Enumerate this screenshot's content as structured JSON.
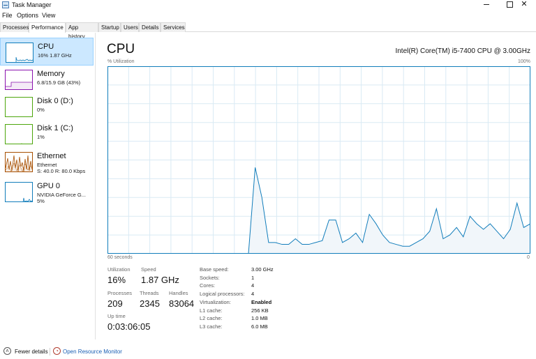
{
  "window": {
    "title": "Task Manager",
    "minimize": "",
    "maximize": "",
    "close": "✕"
  },
  "menu": {
    "items": [
      "File",
      "Options",
      "View"
    ]
  },
  "tabs": [
    "Processes",
    "Performance",
    "App history",
    "Startup",
    "Users",
    "Details",
    "Services"
  ],
  "active_tab": "Performance",
  "sidebar": {
    "items": [
      {
        "name": "CPU",
        "sub1": "16%  1.87 GHz",
        "sub2": "",
        "color": "#117dbb",
        "selected": true
      },
      {
        "name": "Memory",
        "sub1": "6.8/15.9 GB (43%)",
        "sub2": "",
        "color": "#8b12ae"
      },
      {
        "name": "Disk 0 (D:)",
        "sub1": "0%",
        "sub2": "",
        "color": "#4da60c"
      },
      {
        "name": "Disk 1 (C:)",
        "sub1": "1%",
        "sub2": "",
        "color": "#4da60c"
      },
      {
        "name": "Ethernet",
        "sub1": "Ethernet",
        "sub2": "S: 40.0  R: 80.0 Kbps",
        "color": "#a74f01"
      },
      {
        "name": "GPU 0",
        "sub1": "NVIDIA GeForce G...",
        "sub2": "5%",
        "color": "#117dbb"
      }
    ]
  },
  "main": {
    "title": "CPU",
    "cpu_model": "Intel(R) Core(TM) i5-7400 CPU @ 3.00GHz",
    "utilization_label": "% Utilization",
    "max_label": "100%",
    "time_label": "60 seconds",
    "min_label": "0",
    "stats": {
      "utilization_label": "Utilization",
      "utilization": "16%",
      "speed_label": "Speed",
      "speed": "1.87 GHz",
      "processes_label": "Processes",
      "processes": "209",
      "threads_label": "Threads",
      "threads": "2345",
      "handles_label": "Handles",
      "handles": "83064",
      "uptime_label": "Up time",
      "uptime": "0:03:06:05"
    },
    "details": [
      {
        "label": "Base speed:",
        "value": "3.00 GHz"
      },
      {
        "label": "Sockets:",
        "value": "1"
      },
      {
        "label": "Cores:",
        "value": "4"
      },
      {
        "label": "Logical processors:",
        "value": "4"
      },
      {
        "label": "Virtualization:",
        "value": "Enabled"
      },
      {
        "label": "L1 cache:",
        "value": "256 KB"
      },
      {
        "label": "L2 cache:",
        "value": "1.0 MB"
      },
      {
        "label": "L3 cache:",
        "value": "6.0 MB"
      }
    ]
  },
  "footer": {
    "fewer_details": "Fewer details",
    "open_resource_monitor": "Open Resource Monitor"
  },
  "colors": {
    "cpu_line": "#117dbb",
    "cpu_fill": "#f1f6fa",
    "grid": "#d9eaf4",
    "border": "#117dbb"
  },
  "chart_data": {
    "type": "area",
    "ylim": [
      0,
      100
    ],
    "x_seconds_ago": [
      60,
      41,
      39,
      37,
      35,
      33,
      31,
      29,
      27,
      26,
      24,
      22,
      20,
      19,
      17,
      16,
      14,
      12,
      11,
      9,
      8,
      6,
      4,
      3,
      2,
      1,
      0
    ],
    "values": [
      0,
      46,
      6,
      6,
      5,
      8,
      5,
      6,
      7,
      18,
      18,
      6,
      11,
      21,
      16,
      10,
      4,
      5,
      8,
      12,
      24,
      8,
      14,
      20,
      19,
      17,
      8
    ],
    "series_full": [
      0,
      0,
      0,
      0,
      0,
      0,
      0,
      0,
      0,
      0,
      0,
      0,
      0,
      0,
      0,
      0,
      0,
      0,
      0,
      0,
      0,
      0,
      46,
      30,
      6,
      6,
      5,
      5,
      8,
      5,
      5,
      6,
      7,
      18,
      18,
      6,
      8,
      11,
      6,
      21,
      16,
      10,
      6,
      5,
      4,
      4,
      6,
      8,
      12,
      24,
      8,
      10,
      14,
      9,
      20,
      16,
      13,
      16,
      12,
      8,
      13,
      27,
      14,
      16
    ]
  }
}
